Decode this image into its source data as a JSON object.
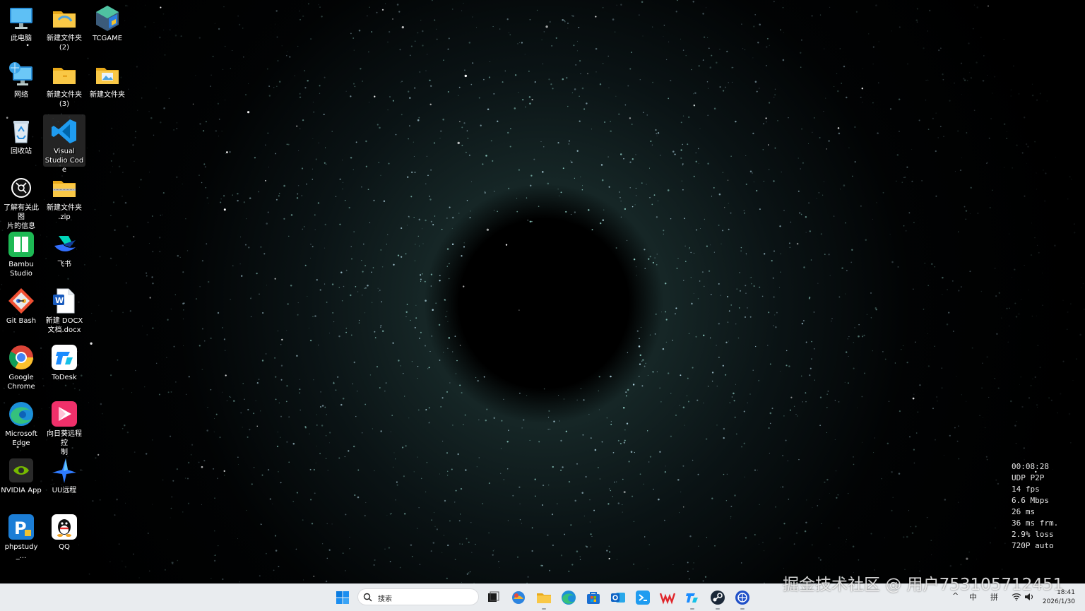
{
  "desktop": {
    "icons": [
      {
        "label": "此电脑",
        "icon": "this-pc-icon"
      },
      {
        "label": "新建文件夹\n(2)",
        "icon": "folder-icon"
      },
      {
        "label": "TCGAME",
        "icon": "tcgame-icon"
      },
      {
        "label": "网络",
        "icon": "network-icon"
      },
      {
        "label": "新建文件夹\n(3)",
        "icon": "folder-icon"
      },
      {
        "label": "新建文件夹",
        "icon": "folder-icon"
      },
      {
        "label": "回收站",
        "icon": "recycle-bin-icon"
      },
      {
        "label": "Visual\nStudio Code",
        "icon": "vscode-icon"
      },
      {
        "label": "了解有关此图\n片的信息",
        "icon": "spotlight-icon"
      },
      {
        "label": "新建文件夹\n.zip",
        "icon": "zip-folder-icon"
      },
      {
        "label": "Bambu\nStudio",
        "icon": "bambu-studio-icon"
      },
      {
        "label": "飞书",
        "icon": "feishu-icon"
      },
      {
        "label": "Git Bash",
        "icon": "git-bash-icon"
      },
      {
        "label": "新建 DOCX\n文档.docx",
        "icon": "word-doc-icon"
      },
      {
        "label": "Google\nChrome",
        "icon": "chrome-icon"
      },
      {
        "label": "ToDesk",
        "icon": "todesk-icon"
      },
      {
        "label": "Microsoft\nEdge",
        "icon": "edge-icon"
      },
      {
        "label": "向日葵远程控\n制",
        "icon": "sunlogin-icon"
      },
      {
        "label": "NVIDIA App",
        "icon": "nvidia-icon"
      },
      {
        "label": "UU远程",
        "icon": "uu-remote-icon"
      },
      {
        "label": "phpstudy_...",
        "icon": "phpstudy-icon"
      },
      {
        "label": "QQ",
        "icon": "qq-icon"
      }
    ]
  },
  "stream_stats": {
    "time": "00:08:28",
    "protocol": "UDP P2P",
    "fps": "14 fps",
    "bitrate": "6.6 Mbps",
    "latency": "26 ms",
    "frame": "36 ms frm.",
    "loss": "2.9% loss",
    "resolution": "720P auto"
  },
  "watermark": "掘金技术社区 @ 用户753105712451",
  "taskbar": {
    "search_placeholder": "搜索",
    "apps": [
      "start-icon",
      "task-view-icon",
      "widgets-icon",
      "file-explorer-icon",
      "edge-icon",
      "store-icon",
      "outlook-icon",
      "vscode-app-icon",
      "wps-icon",
      "todesk-icon",
      "steam-icon",
      "network-tool-icon"
    ],
    "tray": {
      "chevron": "^",
      "ime_lang": "中",
      "ime_mode": "拼",
      "time": "18:41",
      "date": "2026/1/30"
    }
  }
}
